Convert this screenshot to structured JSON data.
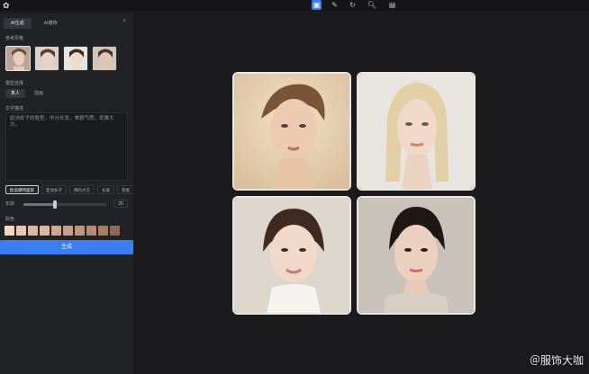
{
  "toolbar": {
    "logo_icon": "app-logo-icon",
    "buttons": [
      {
        "name": "select-tool",
        "icon": "▣",
        "active": true
      },
      {
        "name": "brush-tool",
        "icon": "✎",
        "active": false
      },
      {
        "name": "rotate-tool",
        "icon": "↻",
        "active": false
      },
      {
        "name": "zoom-tool",
        "icon": "🔍︎",
        "active": false
      },
      {
        "name": "layers-tool",
        "icon": "▤",
        "active": false
      }
    ]
  },
  "panel": {
    "tabs": [
      {
        "label": "AI生成",
        "active": true
      },
      {
        "label": "AI模特",
        "active": false
      }
    ],
    "close": "×",
    "ref_section": "参考风格",
    "style_section": "模型选择",
    "style_pills": [
      {
        "label": "真人",
        "active": true
      },
      {
        "label": "插画",
        "active": false
      }
    ],
    "prompt_section": "文字描述",
    "prompt_text": "欧洲女子的脸型，中分长发，美貌气质，优雅大方。",
    "chips": [
      {
        "label": "欧美模特面部",
        "active": true
      },
      {
        "label": "亚洲女子",
        "active": false
      },
      {
        "label": "简约大方",
        "active": false
      },
      {
        "label": "长发",
        "active": false
      },
      {
        "label": "卷发",
        "active": false
      }
    ],
    "age_label": "年龄",
    "age_value": "25",
    "age_fraction": 0.38,
    "color_section": "肤色",
    "swatches": [
      "#f1d6c2",
      "#e9c8b0",
      "#ddb79c",
      "#d9b7a2",
      "#cfa78c",
      "#c99f86",
      "#c39479",
      "#b98a6e",
      "#a87d63",
      "#8d6a55"
    ],
    "generate_label": "生成"
  },
  "watermark": "＠服饰大咖"
}
